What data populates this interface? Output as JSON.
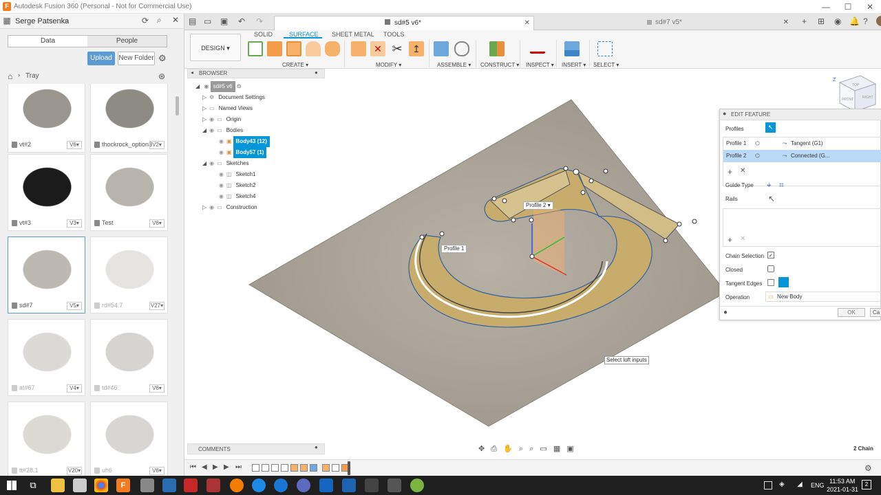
{
  "window": {
    "title": "Autodesk Fusion 360 (Personal - Not for Commercial Use)",
    "app_icon": "F"
  },
  "data_panel": {
    "user": "Serge Patsenka",
    "tabs": [
      "Data",
      "People"
    ],
    "upload_label": "Upload",
    "new_folder_label": "New Folder",
    "location": "Tray",
    "items": [
      {
        "name": "vt#2",
        "version": "V6▾",
        "faded": false
      },
      {
        "name": "thockrock_option3",
        "version": "V2▾",
        "faded": false
      },
      {
        "name": "vt#3",
        "version": "V3▾",
        "faded": false
      },
      {
        "name": "Test",
        "version": "V6▾",
        "faded": false
      },
      {
        "name": "sd#7",
        "version": "V5▾",
        "faded": false
      },
      {
        "name": "rd#54.7",
        "version": "V27▾",
        "faded": true
      },
      {
        "name": "at#67",
        "version": "V4▾",
        "faded": true
      },
      {
        "name": "td#46",
        "version": "V6▾",
        "faded": true
      },
      {
        "name": "tt#28.1",
        "version": "V20▾",
        "faded": true
      },
      {
        "name": "uh6",
        "version": "V6▾",
        "faded": true
      }
    ]
  },
  "doc_tabs": [
    {
      "label": "sd#5 v6*",
      "active": true
    },
    {
      "label": "sd#7 v5*",
      "active": false
    }
  ],
  "toolbar": {
    "workspace": "DESIGN ▾",
    "tabs": [
      "SOLID",
      "SURFACE",
      "SHEET METAL",
      "TOOLS"
    ],
    "active_tab": "SURFACE",
    "groups": [
      "CREATE ▾",
      "MODIFY ▾",
      "ASSEMBLE ▾",
      "CONSTRUCT ▾",
      "INSPECT ▾",
      "INSERT ▾",
      "SELECT ▾"
    ]
  },
  "browser": {
    "title": "BROWSER",
    "doc_node": "sd#5 v6",
    "nodes": [
      {
        "label": "Document Settings",
        "hl": false
      },
      {
        "label": "Named Views",
        "hl": false
      },
      {
        "label": "Origin",
        "hl": false
      },
      {
        "label": "Bodies",
        "hl": false
      },
      {
        "label": "Body43 (12)",
        "hl": true
      },
      {
        "label": "Body57 (1)",
        "hl": true
      },
      {
        "label": "Sketches",
        "hl": false
      },
      {
        "label": "Sketch1",
        "hl": false
      },
      {
        "label": "Sketch2",
        "hl": false
      },
      {
        "label": "Sketch4",
        "hl": false
      },
      {
        "label": "Construction",
        "hl": false
      }
    ]
  },
  "viewcube": {
    "top": "TOP",
    "front": "FRONT",
    "right": "RIGHT",
    "axis": "Z"
  },
  "edit_feature": {
    "title": "EDIT FEATURE",
    "profiles_label": "Profiles",
    "profile_rows": [
      {
        "name": "Profile 1",
        "continuity": "Tangent (G1)"
      },
      {
        "name": "Profile 2",
        "continuity": "Connected (G..."
      }
    ],
    "guide_type_label": "Guide Type",
    "rails_label": "Rails",
    "chain_selection_label": "Chain Selection",
    "closed_label": "Closed",
    "tangent_edges_label": "Tangent Edges",
    "operation_label": "Operation",
    "operation_value": "New Body",
    "ok_label": "OK",
    "cancel_label": "Ca"
  },
  "canvas": {
    "profile1_label": "Profile 1",
    "profile2_label": "Profile 2 ▾",
    "tooltip": "Select loft inputs",
    "chain_count": "2 Chain"
  },
  "comments_label": "COMMENTS",
  "taskbar": {
    "time": "11:53 AM",
    "date": "2021-01-31",
    "lang": "ENG",
    "notif": "2"
  }
}
